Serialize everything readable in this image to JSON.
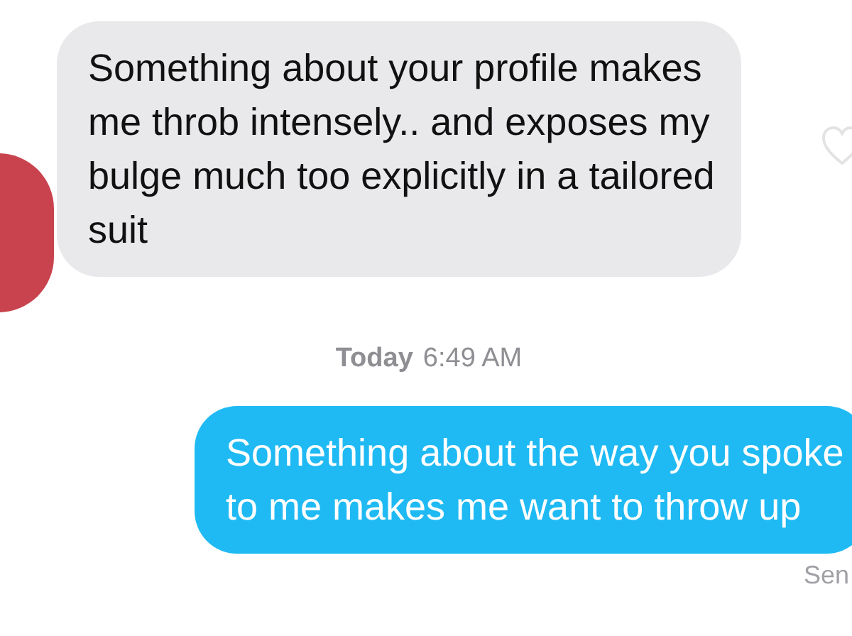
{
  "messages": [
    {
      "kind": "incoming",
      "text": "Something about your profile makes me throb intensely.. and exposes my bulge much too explicitly in a tailored suit"
    },
    {
      "kind": "timestamp",
      "day": "Today",
      "time": "6:49 AM"
    },
    {
      "kind": "outgoing",
      "text": "Something about the way you spoke to me makes me want to throw up",
      "status": "Sen"
    }
  ]
}
